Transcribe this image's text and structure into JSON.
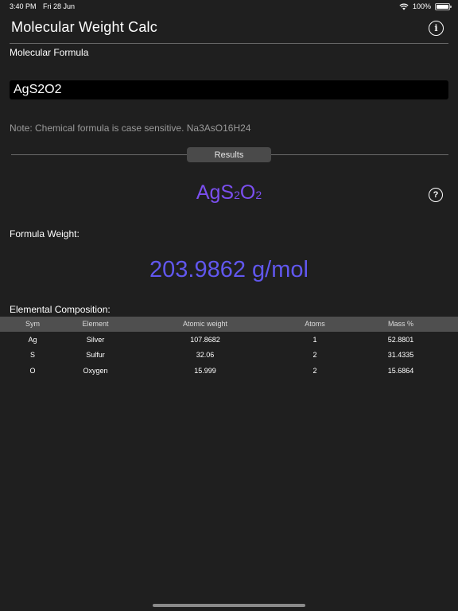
{
  "status_bar": {
    "time": "3:40 PM",
    "date": "Fri 28 Jun",
    "battery": "100%",
    "battery_level": 1.0
  },
  "nav": {
    "title": "Molecular Weight Calc",
    "info_icon": "info-icon"
  },
  "input_section": {
    "label": "Molecular Formula",
    "value": "AgS2O2",
    "note": "Note: Chemical formula is case sensitive. Na3AsO16H24"
  },
  "results": {
    "header": "Results",
    "formula_parts": [
      {
        "text": "Ag",
        "sub": false
      },
      {
        "text": "S",
        "sub": false
      },
      {
        "text": "2",
        "sub": true
      },
      {
        "text": "O",
        "sub": false
      },
      {
        "text": "2",
        "sub": true
      }
    ],
    "help_icon": "question-circle-icon",
    "weight_label": "Formula Weight:",
    "weight_value": "203.9862 g/mol",
    "composition_label": "Elemental Composition:"
  },
  "composition": {
    "columns": [
      "Sym",
      "Element",
      "Atomic weight",
      "Atoms",
      "Mass %"
    ],
    "rows": [
      [
        "Ag",
        "Silver",
        "107.8682",
        "1",
        "52.8801"
      ],
      [
        "S",
        "Sulfur",
        "32.06",
        "2",
        "31.4335"
      ],
      [
        "O",
        "Oxygen",
        "15.999",
        "2",
        "15.6864"
      ]
    ]
  },
  "colors": {
    "background": "#1f1f1f",
    "formula_purple": "#7b4ff0",
    "weight_blue": "#6157ee",
    "table_header": "#4f4f4f"
  }
}
